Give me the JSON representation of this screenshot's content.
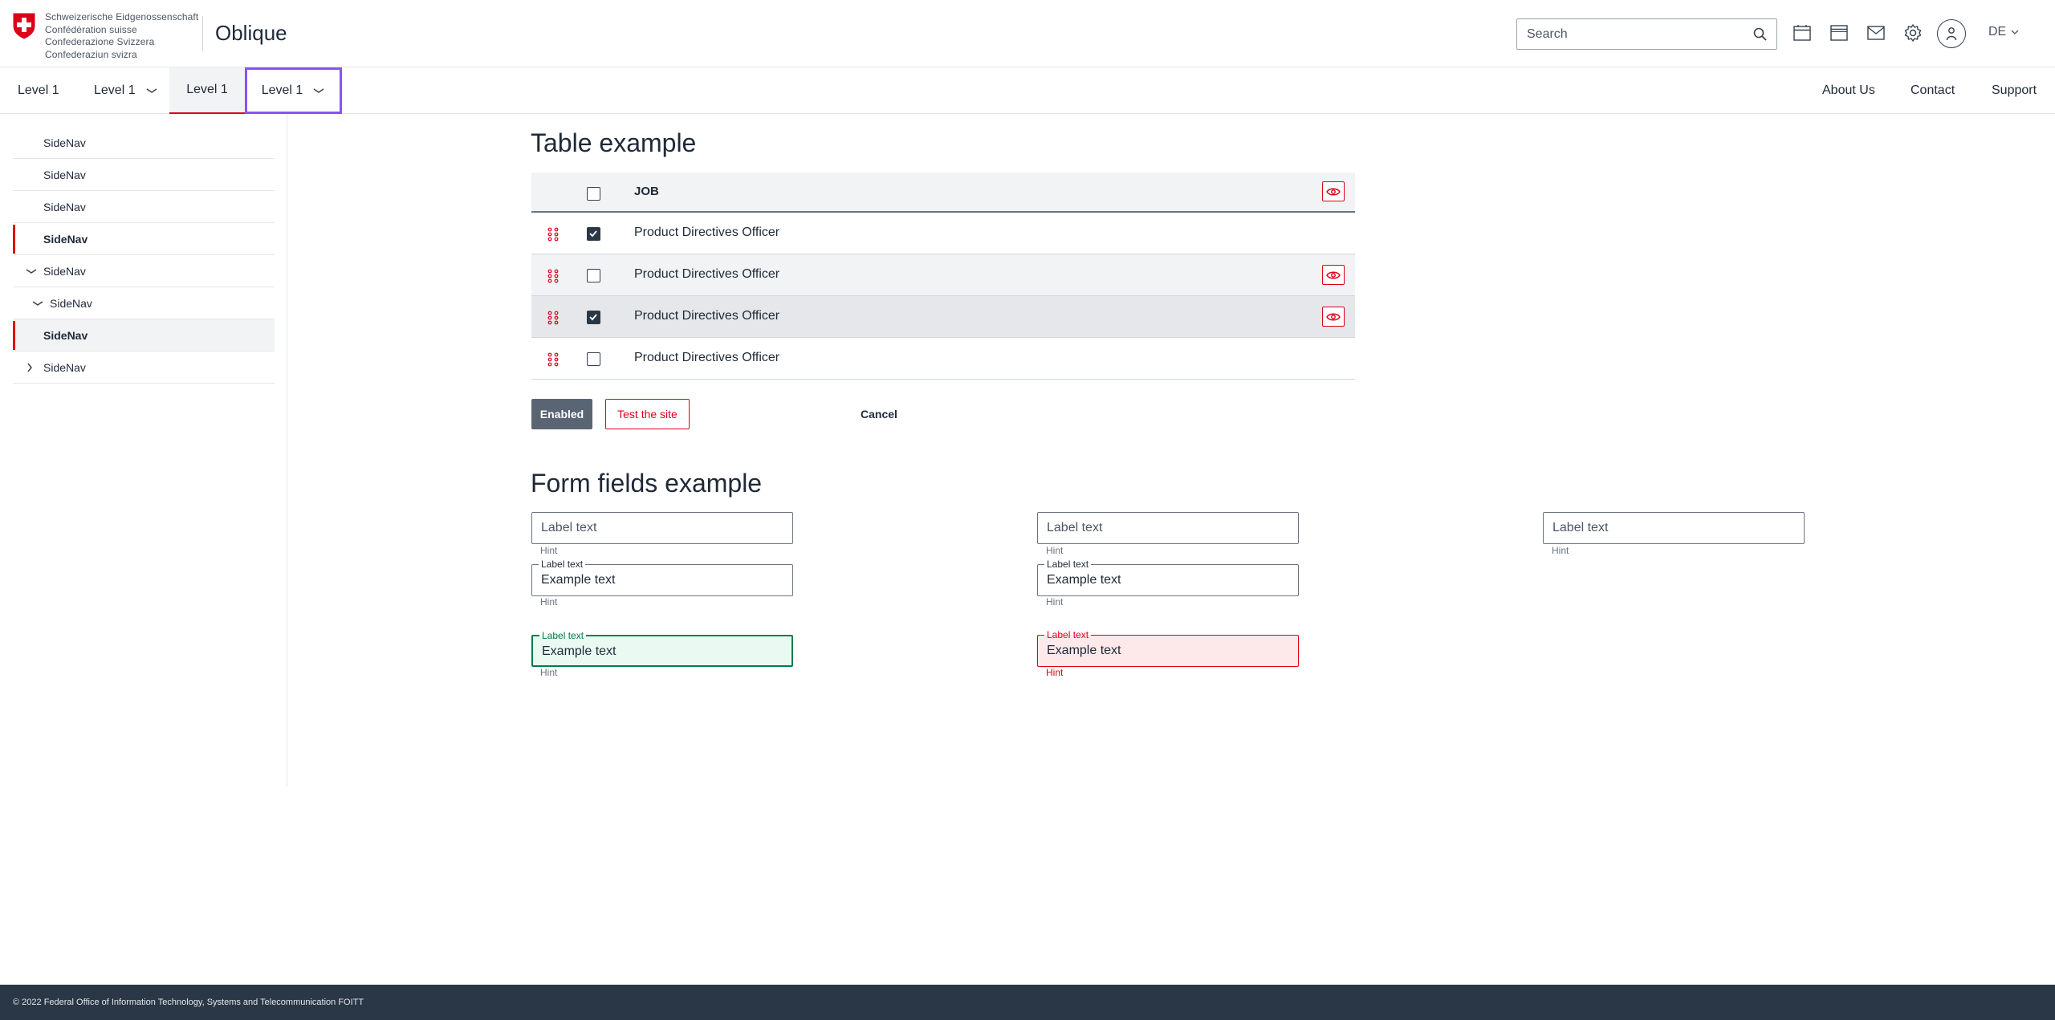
{
  "header": {
    "confederation_lines": [
      "Schweizerische Eidgenossenschaft",
      "Confédération suisse",
      "Confederazione Svizzera",
      "Confederaziun svizra"
    ],
    "app_title": "Oblique",
    "search_placeholder": "Search",
    "language": "DE"
  },
  "topnav": {
    "items": [
      {
        "label": "Level 1"
      },
      {
        "label": "Level 1"
      },
      {
        "label": "Level 1"
      },
      {
        "label": "Level 1"
      }
    ],
    "right": [
      {
        "label": "About Us"
      },
      {
        "label": "Contact"
      },
      {
        "label": "Support"
      }
    ]
  },
  "sidebar": {
    "items": [
      {
        "label": "SideNav"
      },
      {
        "label": "SideNav"
      },
      {
        "label": "SideNav"
      },
      {
        "label": "SideNav"
      },
      {
        "label": "SideNav"
      },
      {
        "label": "SideNav"
      },
      {
        "label": "SideNav"
      },
      {
        "label": "SideNav"
      }
    ]
  },
  "table_section": {
    "title": "Table example",
    "header": "JOB",
    "rows": [
      {
        "job": "Product Directives Officer",
        "checked": true
      },
      {
        "job": "Product Directives Officer",
        "checked": false
      },
      {
        "job": "Product Directives Officer",
        "checked": true
      },
      {
        "job": "Product Directives Officer",
        "checked": false
      }
    ],
    "buttons": {
      "enabled": "Enabled",
      "test": "Test the site",
      "cancel": "Cancel"
    }
  },
  "form_section": {
    "title": "Form fields example",
    "empty_label": "Label text",
    "float_label": "Label text",
    "value": "Example text",
    "hint": "Hint"
  },
  "footer": {
    "text": "© 2022 Federal Office of Information Technology, Systems and Telecommunication FOITT"
  },
  "colors": {
    "brand_red": "#dc0018",
    "dark": "#2a3746",
    "focus": "#8655f6",
    "success": "#007d4a"
  }
}
